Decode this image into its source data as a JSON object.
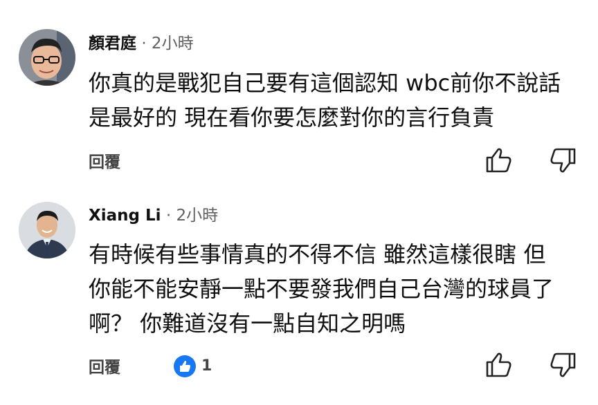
{
  "comments": [
    {
      "author": "顏君庭",
      "time": "· 2小時",
      "lines": [
        "你真的是戰犯自己要有這個認知 wbc前你不說話",
        "是最好的 現在看你要怎麼對你的言行負責"
      ],
      "reply_label": "回覆"
    },
    {
      "author": "Xiang Li",
      "time": "· 2小時",
      "lines": [
        "有時候有些事情真的不得不信 雖然這樣很瞎 但",
        "你能不能安靜一點不要發我們自己台灣的球員了",
        "啊？ 你難道沒有一點自知之明嗎"
      ],
      "reply_label": "回覆",
      "like_count": "1"
    }
  ],
  "icons": {
    "like": "thumbs-up-icon",
    "dislike": "thumbs-down-icon",
    "like_badge": "blue-like-badge-icon"
  },
  "colors": {
    "accent_blue": "#1877f2",
    "meta_gray": "#606060"
  }
}
